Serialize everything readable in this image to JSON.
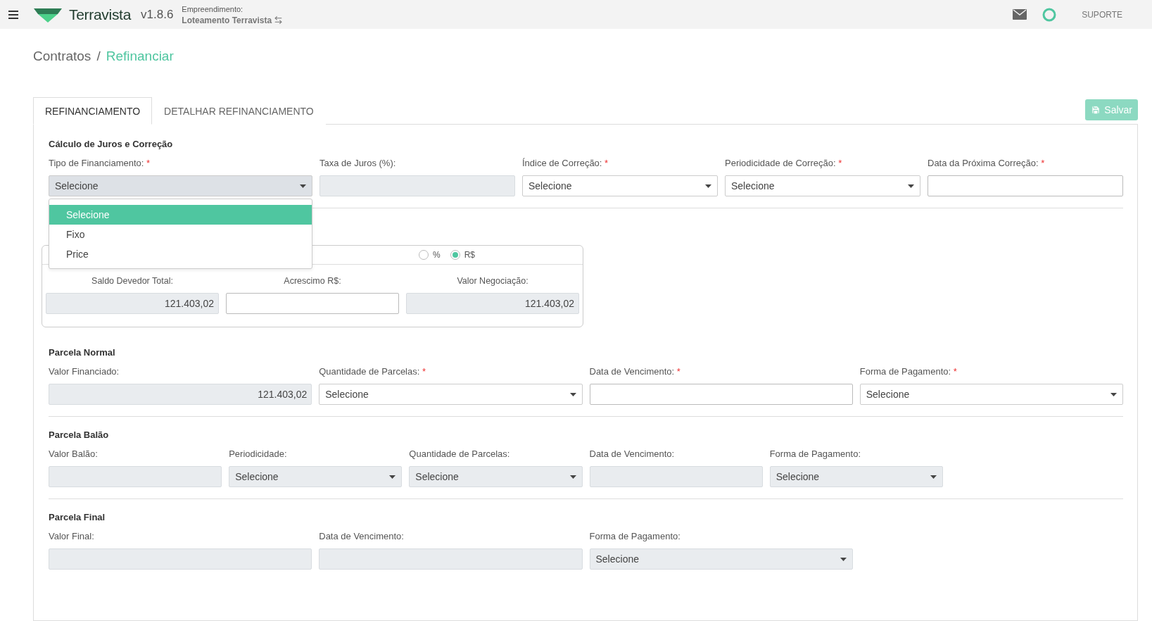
{
  "header": {
    "brand": "Terravista",
    "version": "v1.8.6",
    "project_label": "Empreendimento:",
    "project_name": "Loteamento Terravista",
    "support": "SUPORTE"
  },
  "breadcrumb": {
    "items": [
      "Contratos",
      "Refinanciar"
    ],
    "separator": "/"
  },
  "tabs": [
    {
      "label": "REFINANCIAMENTO",
      "selected": true
    },
    {
      "label": "DETALHAR REFINANCIAMENTO",
      "selected": false
    }
  ],
  "save_button": {
    "label": "Salvar",
    "disabled": true
  },
  "required_mark": "*",
  "sections": [
    {
      "kind": "calc",
      "title": "Cálculo de Juros e Correção",
      "fields": [
        {
          "label": "Tipo de Financiamento:",
          "required": true,
          "kind": "select",
          "value": "Selecione",
          "disabled": false,
          "open": true,
          "options": [
            {
              "label": "Selecione",
              "selected": true
            },
            {
              "label": "Fixo",
              "selected": false
            },
            {
              "label": "Price",
              "selected": false
            }
          ]
        },
        {
          "label": "Taxa de Juros (%):",
          "required": false,
          "kind": "text",
          "disabled": true
        },
        {
          "label": "Índice de Correção:",
          "required": true,
          "kind": "select",
          "value": "Selecione",
          "disabled": false,
          "open": false
        },
        {
          "label": "Periodicidade de Correção:",
          "required": true,
          "kind": "select",
          "value": "Selecione",
          "disabled": false,
          "open": false
        },
        {
          "label": "Data da Próxima Correção:",
          "required": true,
          "kind": "text",
          "disabled": false
        }
      ]
    },
    {
      "kind": "normal",
      "title": "Parcela Normal",
      "fields": [
        {
          "label": "Valor Financiado:",
          "required": false,
          "kind": "text",
          "value": "121.403,02",
          "disabled": true
        },
        {
          "label": "Quantidade de Parcelas:",
          "required": true,
          "kind": "select",
          "value": "Selecione",
          "disabled": false,
          "open": false
        },
        {
          "label": "Data de Vencimento:",
          "required": true,
          "kind": "text",
          "disabled": false
        },
        {
          "label": "Forma de Pagamento:",
          "required": true,
          "kind": "select",
          "value": "Selecione",
          "disabled": false,
          "open": false
        }
      ]
    },
    {
      "kind": "balloon",
      "title": "Parcela Balão",
      "fields": [
        {
          "label": "Valor Balão:",
          "required": false,
          "kind": "text",
          "disabled": true
        },
        {
          "label": "Periodicidade:",
          "required": false,
          "kind": "select",
          "value": "Selecione",
          "disabled": true,
          "open": false
        },
        {
          "label": "Quantidade de Parcelas:",
          "required": false,
          "kind": "select",
          "value": "Selecione",
          "disabled": true,
          "open": false
        },
        {
          "label": "Data de Vencimento:",
          "required": false,
          "kind": "text",
          "disabled": true
        },
        {
          "label": "Forma de Pagamento:",
          "required": false,
          "kind": "select",
          "value": "Selecione",
          "disabled": true,
          "open": false
        }
      ]
    },
    {
      "kind": "final",
      "title": "Parcela Final",
      "fields": [
        {
          "label": "Valor Final:",
          "required": false,
          "kind": "text",
          "disabled": true
        },
        {
          "label": "Data de Vencimento:",
          "required": false,
          "kind": "text",
          "disabled": true
        },
        {
          "label": "Forma de Pagamento:",
          "required": false,
          "kind": "select",
          "value": "Selecione",
          "disabled": true,
          "open": false
        }
      ]
    }
  ],
  "negotiation": {
    "modes": [
      {
        "label": "%",
        "selected": false
      },
      {
        "label": "R$",
        "selected": true
      }
    ],
    "fields": [
      {
        "label": "Saldo Devedor Total:",
        "value": "121.403,02",
        "disabled": true
      },
      {
        "label": "Acrescimo R$:",
        "disabled": false
      },
      {
        "label": "Valor Negociação:",
        "value": "121.403,02",
        "disabled": true
      }
    ]
  }
}
